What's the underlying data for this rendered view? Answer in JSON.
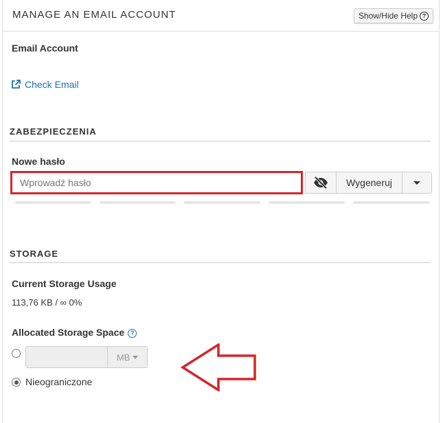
{
  "header": {
    "title": "MANAGE AN EMAIL ACCOUNT",
    "help_button": "Show/Hide Help",
    "help_icon": "?"
  },
  "account": {
    "label": "Email Account",
    "check_email": "Check Email"
  },
  "security": {
    "section_title": "ZABEZPIECZENIA",
    "password_label": "Nowe hasło",
    "password_placeholder": "Wprowadź hasło",
    "generate_label": "Wygeneruj",
    "strength_segments": 5
  },
  "storage": {
    "section_title": "STORAGE",
    "usage_label": "Current Storage Usage",
    "usage_value": "113,76 KB / ∞ 0%",
    "allocated_label": "Allocated Storage Space",
    "help_icon": "?",
    "unit": "MB",
    "unlimited_label": "Nieograniczone",
    "selected_option": "unlimited"
  },
  "colors": {
    "link": "#1a73b5",
    "highlight": "#d8232a"
  },
  "annotations": {
    "highlight": "password-input",
    "arrow_direction": "left"
  }
}
